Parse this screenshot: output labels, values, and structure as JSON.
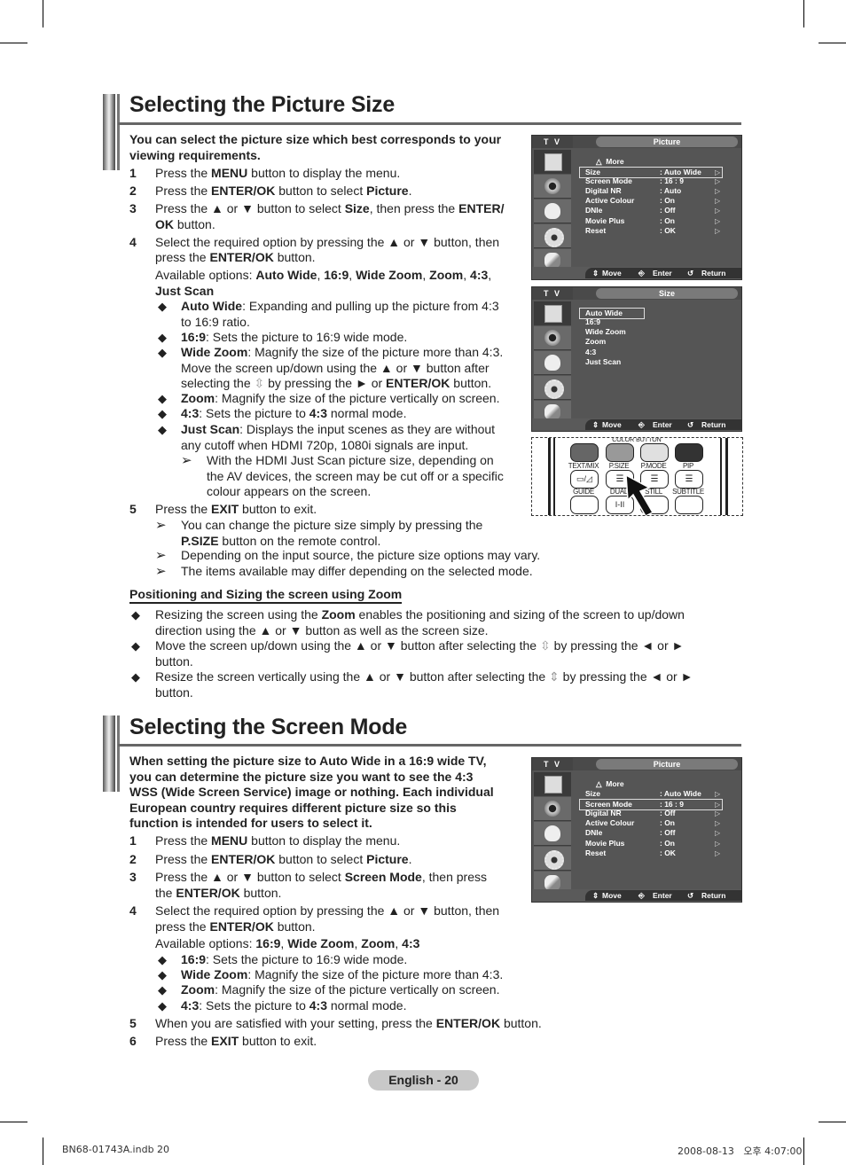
{
  "section1": {
    "title": "Selecting the Picture Size",
    "intro": "You can select the picture size which best corresponds to your viewing requirements.",
    "steps": [
      {
        "num": "1",
        "pre": "Press the ",
        "b1": "MENU",
        "post": " button to display the menu."
      },
      {
        "num": "2",
        "pre": "Press the ",
        "b1": "ENTER/OK",
        "mid": " button to select ",
        "b2": "Picture",
        "post": "."
      },
      {
        "num": "3",
        "pre": "Press the ▲ or ▼ button to select ",
        "b1": "Size",
        "mid": ", then press the ",
        "b2": "ENTER/",
        "line2b": "OK",
        "post": " button."
      },
      {
        "num": "4",
        "pre": "Select the required option by pressing the ▲ or ▼ button, then",
        "line2pre": "press the ",
        "b1": "ENTER/OK",
        "post": " button."
      }
    ],
    "available_label": "Available options: ",
    "available_options": [
      "Auto Wide",
      "16:9",
      "Wide Zoom",
      "Zoom",
      "4:3",
      "Just Scan"
    ],
    "options": [
      {
        "name": "Auto Wide",
        "desc": ": Expanding and pulling up the picture from 4:3",
        "desc2": "to 16:9 ratio."
      },
      {
        "name": "16:9",
        "desc": ": Sets the picture to 16:9 wide mode."
      },
      {
        "name": "Wide Zoom",
        "desc": ": Magnify the size of the picture more than 4:3.",
        "desc2": "Move the screen up/down using the ▲ or ▼ button after",
        "desc3pre": "selecting the ",
        "desc3mid": " by pressing the ► or ",
        "desc3b": "ENTER/OK",
        "desc3post": " button."
      },
      {
        "name": "Zoom",
        "desc": ": Magnify the size of the picture vertically on screen."
      },
      {
        "name": "4:3",
        "desc": ": Sets the picture to ",
        "descb": "4:3",
        "descpost": " normal mode."
      },
      {
        "name": "Just Scan",
        "desc": ": Displays the input scenes as they are without",
        "desc2": "any cutoff when HDMI 720p, 1080i signals are input."
      }
    ],
    "just_scan_note": [
      "With the HDMI Just Scan picture size, depending on",
      "the AV devices, the screen may be cut off or a specific",
      "colour appears on the screen."
    ],
    "step5": {
      "num": "5",
      "pre": "Press the ",
      "b1": "EXIT",
      "post": " button to exit."
    },
    "notes": [
      {
        "line1": "You can change the picture size simply by pressing the",
        "b": "P.SIZE",
        "line2": " button on the remote control."
      },
      {
        "line1": "Depending on the input source, the picture size options may vary."
      },
      {
        "line1": "The items available may differ depending on the selected mode."
      }
    ]
  },
  "zoom_section": {
    "heading": "Positioning and Sizing the screen using Zoom",
    "items": [
      {
        "pre": "Resizing the screen using the ",
        "b": "Zoom",
        "post": " enables the positioning and sizing of the screen to up/down",
        "line2": "direction using the ▲ or ▼ button as well as the screen size."
      },
      {
        "pre": "Move the screen up/down using the ▲ or ▼ button after selecting the ",
        "post": " by pressing the ◄ or ►",
        "line2": "button."
      },
      {
        "pre": "Resize the screen vertically using the ▲ or ▼ button after selecting the ",
        "post": " by pressing the ◄ or ►",
        "line2": "button."
      }
    ]
  },
  "section2": {
    "title": "Selecting the Screen Mode",
    "intro": [
      "When setting the picture size to Auto Wide in a 16:9 wide TV,",
      "you can determine the picture size you want to see the 4:3",
      "WSS (Wide Screen Service) image or nothing. Each individual",
      "European country requires different picture size so this",
      "function is intended for users to select it."
    ],
    "steps": [
      {
        "num": "1",
        "pre": "Press the ",
        "b1": "MENU",
        "post": " button to display the menu."
      },
      {
        "num": "2",
        "pre": "Press the ",
        "b1": "ENTER/OK",
        "mid": " button to select ",
        "b2": "Picture",
        "post": "."
      },
      {
        "num": "3",
        "pre": "Press the ▲ or ▼ button to select ",
        "b1": "Screen Mode",
        "mid": ", then press",
        "line2pre": "the ",
        "b2": "ENTER/OK",
        "post": " button."
      },
      {
        "num": "4",
        "pre": "Select the required option by pressing the ▲ or ▼ button, then",
        "line2pre": "press the ",
        "b1": "ENTER/OK",
        "post": " button."
      }
    ],
    "available_label": "Available options: ",
    "available_options": [
      "16:9",
      "Wide Zoom",
      "Zoom",
      "4:3"
    ],
    "options": [
      {
        "name": "16:9",
        "desc": ": Sets the picture to 16:9 wide mode."
      },
      {
        "name": "Wide Zoom",
        "desc": ": Magnify the size of the picture more than 4:3."
      },
      {
        "name": "Zoom",
        "desc": ": Magnify the size of the picture vertically on screen."
      },
      {
        "name": "4:3",
        "desc": ": Sets the picture to ",
        "descb": "4:3",
        "descpost": " normal mode."
      }
    ],
    "step5": {
      "num": "5",
      "pre": "When you are satisfied with your setting, press the ",
      "b1": "ENTER/OK",
      "post": " button."
    },
    "step6": {
      "num": "6",
      "pre": "Press the ",
      "b1": "EXIT",
      "post": " button to exit."
    }
  },
  "osd1": {
    "tv_label": "T V",
    "title": "Picture",
    "more": "More",
    "rows": [
      {
        "label": "Size",
        "value": ": Auto Wide",
        "selected": true
      },
      {
        "label": "Screen Mode",
        "value": ": 16 : 9"
      },
      {
        "label": "Digital NR",
        "value": ": Auto"
      },
      {
        "label": "Active Colour",
        "value": ": On"
      },
      {
        "label": "DNIe",
        "value": ": Off"
      },
      {
        "label": "Movie Plus",
        "value": ": On"
      },
      {
        "label": "Reset",
        "value": ": OK"
      }
    ],
    "footer": {
      "move": "Move",
      "enter": "Enter",
      "return": "Return"
    }
  },
  "osd2": {
    "tv_label": "T V",
    "title": "Size",
    "items": [
      "Auto Wide",
      "16:9",
      "Wide Zoom",
      "Zoom",
      "4:3",
      "Just Scan"
    ],
    "selected": "Auto Wide",
    "footer": {
      "move": "Move",
      "enter": "Enter",
      "return": "Return"
    }
  },
  "osd3": {
    "tv_label": "T V",
    "title": "Picture",
    "more": "More",
    "rows": [
      {
        "label": "Size",
        "value": ": Auto Wide"
      },
      {
        "label": "Screen Mode",
        "value": ": 16 : 9",
        "selected": true
      },
      {
        "label": "Digital NR",
        "value": ": Off"
      },
      {
        "label": "Active Colour",
        "value": ": On"
      },
      {
        "label": "DNIe",
        "value": ": Off"
      },
      {
        "label": "Movie Plus",
        "value": ": On"
      },
      {
        "label": "Reset",
        "value": ": OK"
      }
    ],
    "footer": {
      "move": "Move",
      "enter": "Enter",
      "return": "Return"
    }
  },
  "remote": {
    "color_button_label": "COLOR BUTTON",
    "top_labels": [
      "TEXT/MIX",
      "P.SIZE",
      "P.MODE",
      "PIP"
    ],
    "bottom_labels": [
      "GUIDE",
      "DUAL",
      "STILL",
      "SUBTITLE"
    ],
    "dual_glyph": "I-II",
    "color_buttons": [
      "#666666",
      "#999999",
      "#e0e0e0",
      "#333333"
    ]
  },
  "footer": {
    "page_label": "English - 20",
    "file": "BN68-01743A.indb   20",
    "timestamp": "2008-08-13   오후 4:07:00"
  }
}
